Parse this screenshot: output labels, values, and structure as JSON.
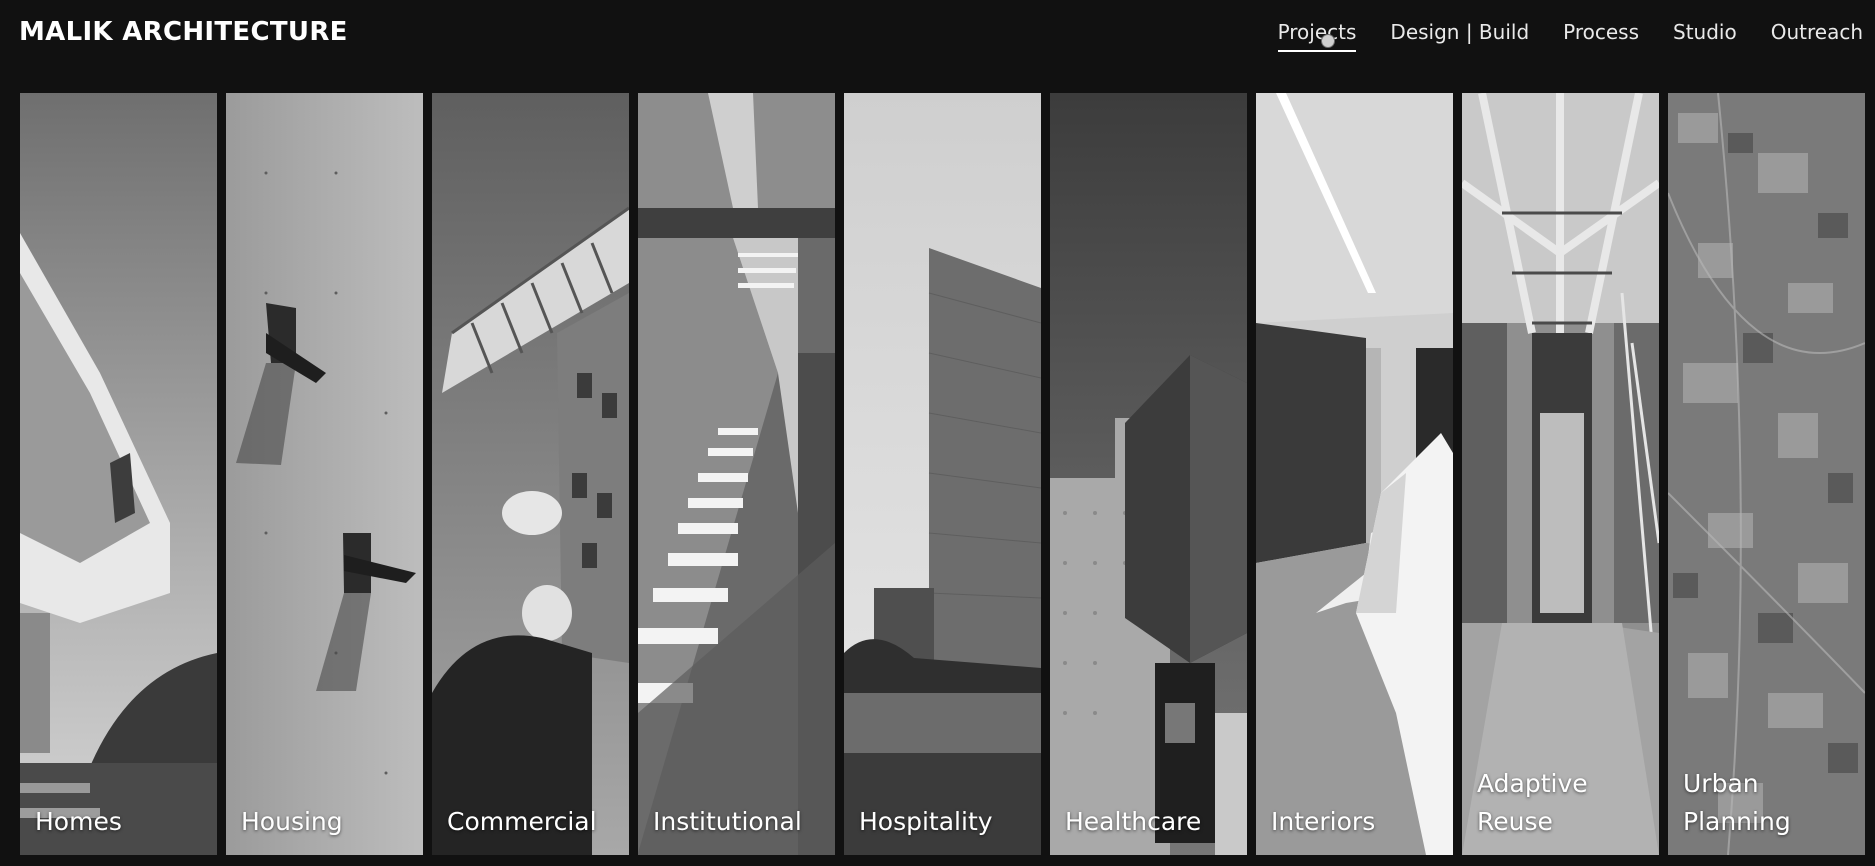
{
  "brand": {
    "name": "MALIK ARCHITECTURE"
  },
  "nav": {
    "items": [
      {
        "label": "Projects",
        "active": true
      },
      {
        "label": "Design | Build",
        "active": false
      },
      {
        "label": "Process",
        "active": false
      },
      {
        "label": "Studio",
        "active": false
      },
      {
        "label": "Outreach",
        "active": false
      }
    ]
  },
  "categories": [
    {
      "label": "Homes",
      "image": "cantilevered-house-photo"
    },
    {
      "label": "Housing",
      "image": "concrete-wall-windows-photo"
    },
    {
      "label": "Commercial",
      "image": "truss-canopy-building-photo"
    },
    {
      "label": "Institutional",
      "image": "light-slit-corridor-photo"
    },
    {
      "label": "Hospitality",
      "image": "stone-tower-photo"
    },
    {
      "label": "Healthcare",
      "image": "brick-block-facade-photo"
    },
    {
      "label": "Interiors",
      "image": "interior-corridor-photo"
    },
    {
      "label": "Adaptive\nReuse",
      "image": "steel-frame-passage-photo"
    },
    {
      "label": "Urban\nPlanning",
      "image": "aerial-settlement-photo"
    }
  ],
  "colors": {
    "background": "#111111",
    "text": "#ffffff"
  }
}
